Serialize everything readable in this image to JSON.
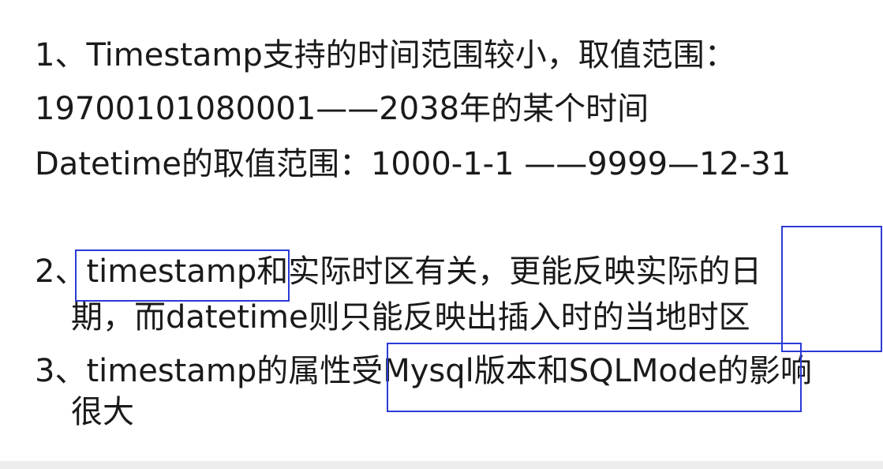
{
  "slide": {
    "lines": [
      "1、Timestamp支持的时间范围较小，取值范围：",
      "19700101080001——2038年的某个时间",
      "Datetime的取值范围：1000-1-1 ——9999—12-31",
      "2、timestamp和实际时区有关，更能反映实际的日",
      "期，而datetime则只能反映出插入时的当地时区",
      "3、timestamp的属性受Mysql版本和SQLMode的影响",
      "很大"
    ]
  },
  "colors": {
    "highlight_box": "#2a3bd6",
    "text": "#1a1a1a",
    "background": "#ffffff"
  }
}
